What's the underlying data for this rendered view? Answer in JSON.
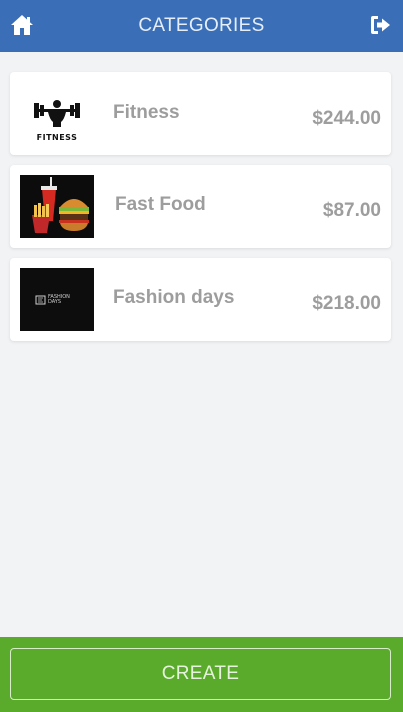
{
  "header": {
    "title": "CATEGORIES",
    "home_icon": "home-icon",
    "logout_icon": "sign-out-icon",
    "background": "#3a6fb7"
  },
  "categories": [
    {
      "name": "Fitness",
      "price": "$244.00",
      "logo_text": "FITNESS"
    },
    {
      "name": "Fast Food",
      "price": "$87.00"
    },
    {
      "name": "Fashion days",
      "price": "$218.00",
      "logo_text": "FASHION DAYS"
    }
  ],
  "footer": {
    "create_label": "CREATE",
    "background": "#5aab2b"
  }
}
